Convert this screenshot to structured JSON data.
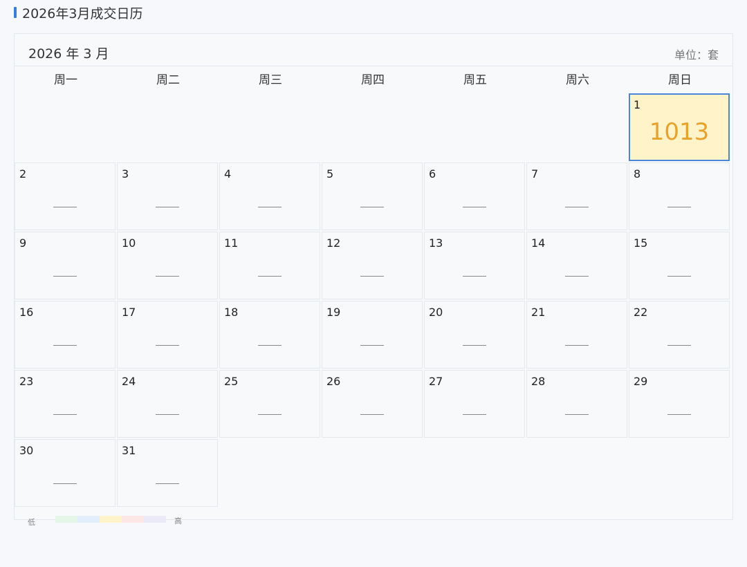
{
  "page": {
    "title": "2026年3月成交日历",
    "accent_color": "#3b7ddd"
  },
  "calendar": {
    "month_label": "2026 年 3 月",
    "unit_label": "单位：套",
    "weekdays": [
      "周一",
      "周二",
      "周三",
      "周四",
      "周五",
      "周六",
      "周日"
    ],
    "empty_value_text": "——",
    "days": [
      {
        "day": "1",
        "value": "1013",
        "highlight": true
      },
      {
        "day": "2",
        "value": "——"
      },
      {
        "day": "3",
        "value": "——"
      },
      {
        "day": "4",
        "value": "——"
      },
      {
        "day": "5",
        "value": "——"
      },
      {
        "day": "6",
        "value": "——"
      },
      {
        "day": "7",
        "value": "——"
      },
      {
        "day": "8",
        "value": "——"
      },
      {
        "day": "9",
        "value": "——"
      },
      {
        "day": "10",
        "value": "——"
      },
      {
        "day": "11",
        "value": "——"
      },
      {
        "day": "12",
        "value": "——"
      },
      {
        "day": "13",
        "value": "——"
      },
      {
        "day": "14",
        "value": "——"
      },
      {
        "day": "15",
        "value": "——"
      },
      {
        "day": "16",
        "value": "——"
      },
      {
        "day": "17",
        "value": "——"
      },
      {
        "day": "18",
        "value": "——"
      },
      {
        "day": "19",
        "value": "——"
      },
      {
        "day": "20",
        "value": "——"
      },
      {
        "day": "21",
        "value": "——"
      },
      {
        "day": "22",
        "value": "——"
      },
      {
        "day": "23",
        "value": "——"
      },
      {
        "day": "24",
        "value": "——"
      },
      {
        "day": "25",
        "value": "——"
      },
      {
        "day": "26",
        "value": "——"
      },
      {
        "day": "27",
        "value": "——"
      },
      {
        "day": "28",
        "value": "——"
      },
      {
        "day": "29",
        "value": "——"
      },
      {
        "day": "30",
        "value": "——"
      },
      {
        "day": "31",
        "value": "——"
      }
    ],
    "highlight_color": "#fff3c9",
    "highlight_border_color": "#4a86d6",
    "highlight_value_color": "#e9a229"
  },
  "legend": {
    "low_label": "低",
    "high_label": "高",
    "colors": [
      "#e3f6e8",
      "#e2eefb",
      "#fff3c9",
      "#fde6e6",
      "#eceaf8"
    ]
  }
}
